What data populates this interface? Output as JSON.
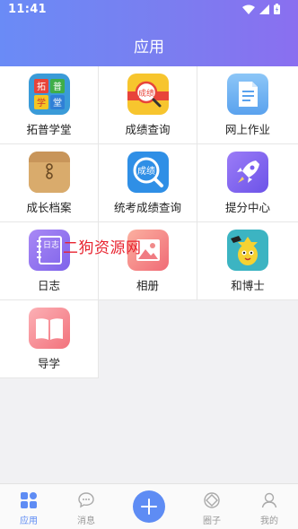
{
  "status_bar": {
    "time": "11:41"
  },
  "header": {
    "title": "应用"
  },
  "apps": [
    [
      {
        "label": "拓普学堂",
        "icon": "tuopu-xuetang-icon"
      },
      {
        "label": "成绩查询",
        "icon": "grade-query-icon"
      },
      {
        "label": "网上作业",
        "icon": "online-homework-icon"
      }
    ],
    [
      {
        "label": "成长档案",
        "icon": "growth-archive-icon"
      },
      {
        "label": "统考成绩查询",
        "icon": "exam-grade-query-icon"
      },
      {
        "label": "提分中心",
        "icon": "rocket-icon"
      }
    ],
    [
      {
        "label": "日志",
        "icon": "diary-icon"
      },
      {
        "label": "相册",
        "icon": "photo-album-icon"
      },
      {
        "label": "和博士",
        "icon": "doctor-he-icon"
      }
    ],
    [
      {
        "label": "导学",
        "icon": "open-book-icon"
      }
    ]
  ],
  "icon_text": {
    "grade_badge": "成绩",
    "exam_badge": "成绩",
    "diary": "日志",
    "tuopu_chars": [
      "拓",
      "普",
      "学",
      "堂"
    ]
  },
  "watermark": "二狗资源网",
  "tabbar": {
    "tabs": [
      {
        "label": "应用",
        "icon": "apps-grid-icon",
        "active": true
      },
      {
        "label": "消息",
        "icon": "chat-bubble-icon",
        "active": false
      },
      {
        "label": "圈子",
        "icon": "circle-icon",
        "active": false
      },
      {
        "label": "我的",
        "icon": "person-icon",
        "active": false
      }
    ]
  },
  "colors": {
    "header_start": "#6a8bf6",
    "header_end": "#8a6ff0",
    "accent": "#5e8cf4",
    "watermark": "#e8232f"
  }
}
